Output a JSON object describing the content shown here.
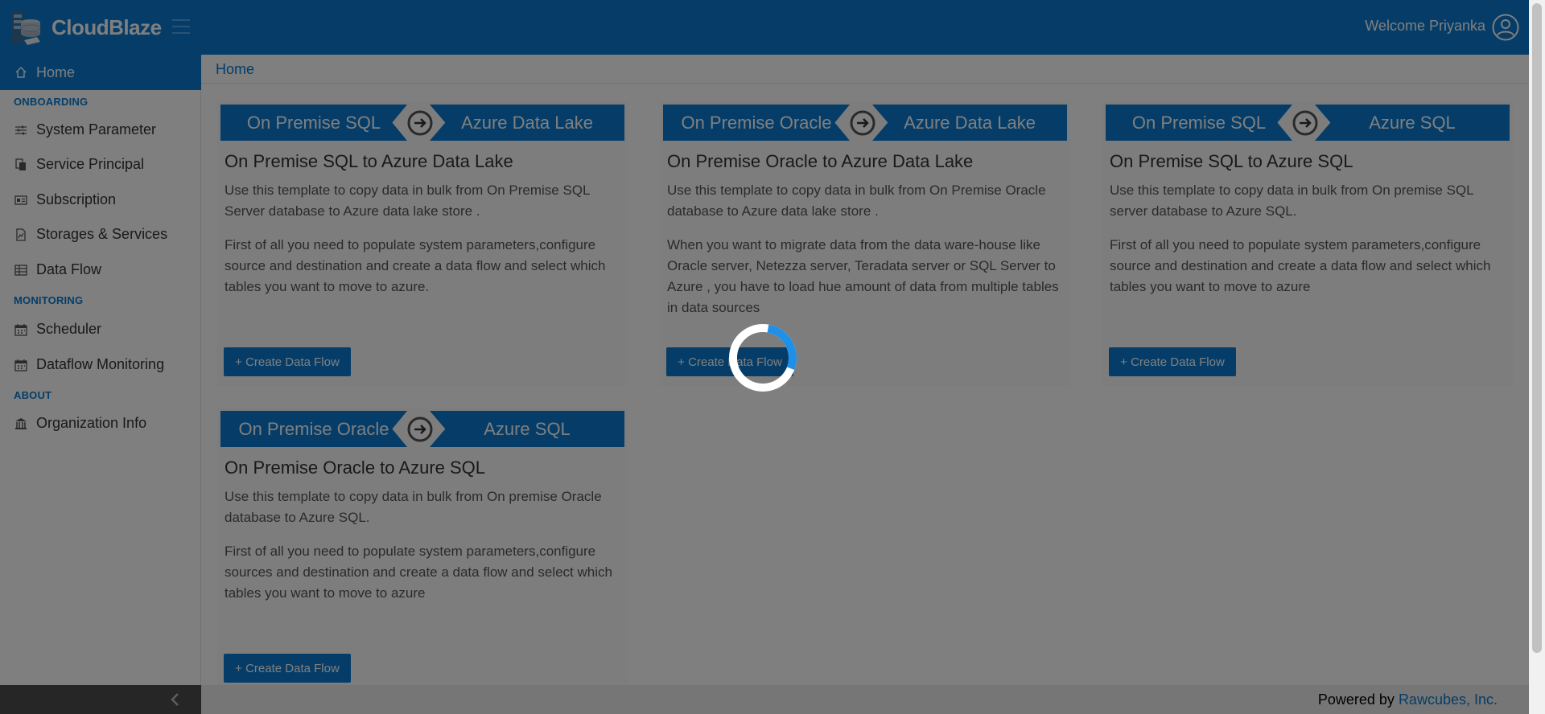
{
  "app": {
    "brand": "CloudBlaze",
    "welcome": "Welcome Priyanka"
  },
  "colors": {
    "primary": "#0a7bd0",
    "overlay": "rgba(0,0,0,0.5)"
  },
  "sidebar": {
    "items": [
      {
        "label": "Home",
        "icon": "home-icon",
        "active": true
      },
      {
        "section": "ONBOARDING"
      },
      {
        "label": "System Parameter",
        "icon": "sliders-icon"
      },
      {
        "label": "Service Principal",
        "icon": "documents-icon"
      },
      {
        "label": "Subscription",
        "icon": "id-card-icon"
      },
      {
        "label": "Storages & Services",
        "icon": "storage-icon"
      },
      {
        "label": "Data Flow",
        "icon": "table-icon"
      },
      {
        "section": "MONITORING"
      },
      {
        "label": "Scheduler",
        "icon": "calendar-icon"
      },
      {
        "label": "Dataflow Monitoring",
        "icon": "calendar-icon"
      },
      {
        "section": "ABOUT"
      },
      {
        "label": "Organization Info",
        "icon": "bank-icon"
      }
    ]
  },
  "breadcrumb": "Home",
  "cards": [
    {
      "source": "On Premise SQL",
      "target": "Azure Data Lake",
      "title": "On Premise SQL to Azure Data Lake",
      "description": "Use this template to copy data in bulk from On Premise SQL Server database to Azure data lake store .",
      "details": "First of all you need to populate system parameters,configure source and destination and create a data flow and select which tables you want to move to azure.",
      "button": "+ Create Data Flow"
    },
    {
      "source": "On Premise Oracle",
      "target": "Azure Data Lake",
      "title": "On Premise Oracle to Azure Data Lake",
      "description": "Use this template to copy data in bulk from On Premise Oracle database to Azure data lake store .",
      "details": "When you want to migrate data from the data ware-house like Oracle server, Netezza server, Teradata server or SQL Server to Azure , you have to load hue amount of data from multiple tables in data sources",
      "button": "+ Create Data Flow"
    },
    {
      "source": "On Premise SQL",
      "target": "Azure SQL",
      "title": "On Premise SQL to Azure SQL",
      "description": "Use this template to copy data in bulk from On premise SQL server database to Azure SQL.",
      "details": "First of all you need to populate system parameters,configure source and destination and create a data flow and select which tables you want to move to azure",
      "button": "+ Create Data Flow"
    },
    {
      "source": "On Premise Oracle",
      "target": "Azure SQL",
      "title": "On Premise Oracle to Azure SQL",
      "description": "Use this template to copy data in bulk from On premise Oracle database to Azure SQL.",
      "details": "First of all you need to populate system parameters,configure sources and destination and create a data flow and select which tables you want to move to azure",
      "button": "+ Create Data Flow"
    }
  ],
  "footer": {
    "prefix": "Powered by",
    "link": "Rawcubes, Inc."
  },
  "loading": {
    "visible": true,
    "progress": 0.28
  }
}
